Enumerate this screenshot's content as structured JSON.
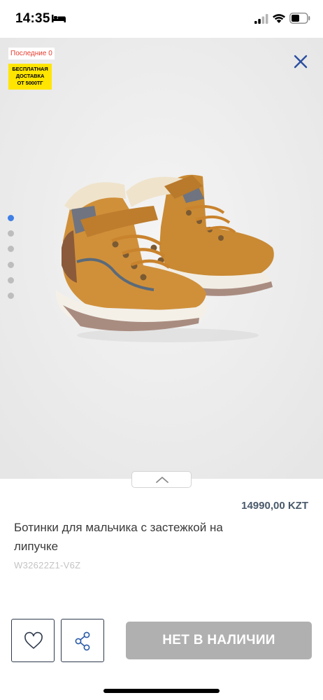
{
  "status_bar": {
    "time": "14:35",
    "icons": [
      "bed-icon",
      "signal-icon",
      "wifi-icon",
      "battery-icon"
    ]
  },
  "gallery": {
    "badge_last": "Последние 0",
    "badge_delivery": [
      "БЕСПЛАТНАЯ",
      "ДОСТАВКА",
      "ОТ 5000ТГ"
    ],
    "image_count": 6,
    "active_index": 0,
    "close_icon": "close-icon",
    "accent_color": "#3f7fe6"
  },
  "product": {
    "price": "14990,00 KZT",
    "title": "Ботинки для мальчика с застежкой на липучке",
    "sku": "W32622Z1-V6Z"
  },
  "actions": {
    "favorite_icon": "heart-icon",
    "share_icon": "share-icon",
    "stock_label": "НЕТ В НАЛИЧИИ",
    "stock_color": "#b0b0b0"
  }
}
